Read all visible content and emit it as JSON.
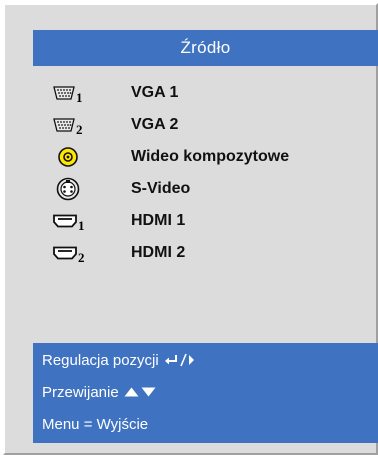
{
  "osd": {
    "title": "Źródło",
    "sources": [
      {
        "label": "VGA 1",
        "icon": "vga-icon",
        "subscript": "1"
      },
      {
        "label": "VGA 2",
        "icon": "vga-icon",
        "subscript": "2"
      },
      {
        "label": "Wideo kompozytowe",
        "icon": "composite-video-icon",
        "subscript": ""
      },
      {
        "label": "S-Video",
        "icon": "s-video-icon",
        "subscript": ""
      },
      {
        "label": "HDMI 1",
        "icon": "hdmi-icon",
        "subscript": "1"
      },
      {
        "label": "HDMI 2",
        "icon": "hdmi-icon",
        "subscript": "2"
      }
    ],
    "help": {
      "adjust": "Regulacja pozycji",
      "scroll": "Przewijanie",
      "exit": "Menu = Wyjście"
    }
  },
  "colors": {
    "panel_bg": "#dcdcdc",
    "accent_blue": "#3f72c0",
    "composite_yellow": "#ffe800"
  }
}
